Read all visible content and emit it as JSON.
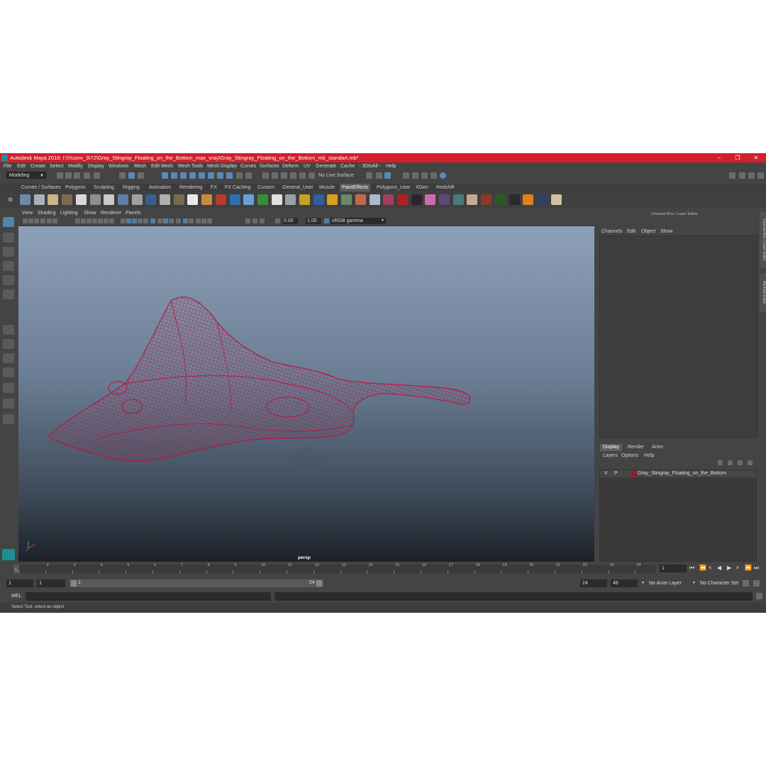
{
  "app": {
    "title": "Autodesk Maya 2016: I:\\!!!conv_3\\72\\Gray_Stingray_Floating_on_the_Bottom_max_vray\\Gray_Stingray_Floating_on_the_Bottom_mb_standart.mb*"
  },
  "window_controls": {
    "minimize": "–",
    "maximize": "❐",
    "close": "✕"
  },
  "menubar": [
    "File",
    "Edit",
    "Create",
    "Select",
    "Modify",
    "Display",
    "Windows",
    "Mesh",
    "Edit Mesh",
    "Mesh Tools",
    "Mesh Display",
    "Curves",
    "Surfaces",
    "Deform",
    "UV",
    "Generate",
    "Cache",
    "- 3DtoAll -",
    "Help"
  ],
  "status": {
    "mode": "Modeling",
    "live_surface": "No Live Surface"
  },
  "shelf_tabs": [
    "Curves / Surfaces",
    "Polygons",
    "Sculpting",
    "Rigging",
    "Animation",
    "Rendering",
    "FX",
    "FX Caching",
    "Custom",
    "General_User",
    "Muscle",
    "PaintEffects",
    "Polygons_User",
    "XGen",
    "Redshift"
  ],
  "shelf_active": "PaintEffects",
  "viewport": {
    "menu": [
      "View",
      "Shading",
      "Lighting",
      "Show",
      "Renderer",
      "Panels"
    ],
    "exposure": "0.00",
    "gamma": "1.00",
    "color_space": "sRGB gamma",
    "camera": "persp",
    "wire_color": "#c0103a"
  },
  "channel_box": {
    "title": "Channel Box / Layer Editor",
    "menu": [
      "Channels",
      "Edit",
      "Object",
      "Show"
    ]
  },
  "layer_editor": {
    "tabs": [
      "Display",
      "Render",
      "Anim"
    ],
    "active_tab": "Display",
    "menu": [
      "Layers",
      "Options",
      "Help"
    ],
    "layers": [
      {
        "visible": "V",
        "playback": "P",
        "name": "Gray_Stingray_Floating_on_the_Bottom",
        "color": "#b0121f"
      }
    ]
  },
  "side_tabs": [
    "Channel Box / Layer Editor",
    "Attribute Editor"
  ],
  "timeline": {
    "ticks": [
      "1",
      "2",
      "3",
      "4",
      "5",
      "6",
      "7",
      "8",
      "9",
      "10",
      "11",
      "12",
      "13",
      "14",
      "15",
      "16",
      "17",
      "18",
      "19",
      "20",
      "21",
      "22",
      "23",
      "24"
    ],
    "current_frame": "1"
  },
  "range": {
    "start": "1",
    "playback_start": "1",
    "slider_start": "1",
    "slider_end": "24",
    "playback_end": "24",
    "end": "48",
    "anim_layer": "No Anim Layer",
    "character_set": "No Character Set"
  },
  "command_line": {
    "lang": "MEL"
  },
  "help_line": "Select Tool: select an object"
}
